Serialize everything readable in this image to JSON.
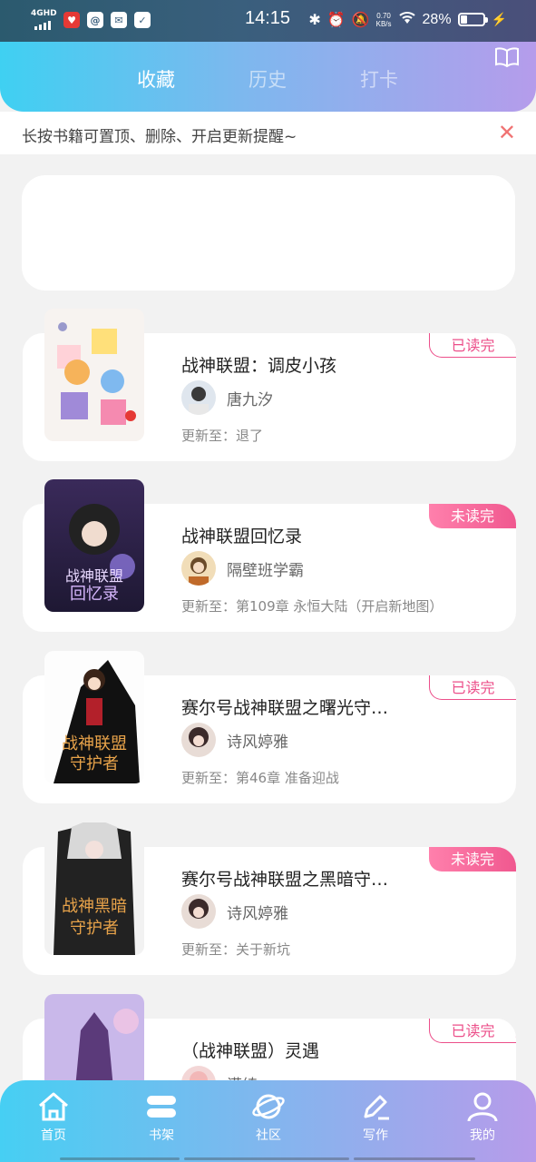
{
  "status_bar": {
    "network": "4GHD",
    "time": "14:15",
    "speed_value": "0.70",
    "speed_unit": "KB/s",
    "battery": "28%",
    "battery_level": 0.28
  },
  "header": {
    "tabs": [
      {
        "label": "收藏",
        "active": true
      },
      {
        "label": "历史",
        "active": false
      },
      {
        "label": "打卡",
        "active": false
      }
    ],
    "book_icon": "open-book-icon"
  },
  "tip": {
    "text": "长按书籍可置顶、删除、开启更新提醒~",
    "close_icon": "close-icon"
  },
  "books": [
    {
      "title": "战神联盟：调皮小孩",
      "author": "唐九汐",
      "update": "更新至：退了",
      "badge": "已读完",
      "badge_type": "read"
    },
    {
      "title": "战神联盟回忆录",
      "author": "隔壁班学霸",
      "update": "更新至：第109章 永恒大陆（开启新地图）",
      "badge": "未读完",
      "badge_type": "unread"
    },
    {
      "title": "赛尔号战神联盟之曙光守…",
      "author": "诗风婷雅",
      "update": "更新至：第46章  准备迎战",
      "badge": "已读完",
      "badge_type": "read"
    },
    {
      "title": "赛尔号战神联盟之黑暗守…",
      "author": "诗风婷雅",
      "update": "更新至：关于新坑",
      "badge": "未读完",
      "badge_type": "unread"
    },
    {
      "title": "（战神联盟）灵遇",
      "author": "满绮",
      "update": "",
      "badge": "已读完",
      "badge_type": "read"
    }
  ],
  "bottom_nav": [
    {
      "label": "首页",
      "icon": "home-icon"
    },
    {
      "label": "书架",
      "icon": "bookshelf-icon"
    },
    {
      "label": "社区",
      "icon": "planet-icon"
    },
    {
      "label": "写作",
      "icon": "pen-icon"
    },
    {
      "label": "我的",
      "icon": "user-icon"
    }
  ]
}
